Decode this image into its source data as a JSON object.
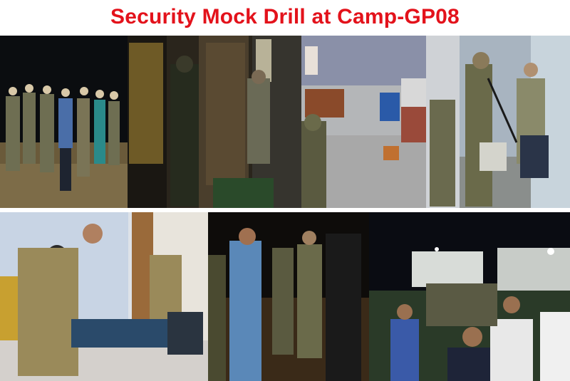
{
  "title": "Security Mock Drill at Camp-GP08",
  "colors": {
    "title": "#e3121b",
    "background": "#ffffff"
  },
  "photos": [
    {
      "name": "night-lineup-photo",
      "depicts": "uniformed personnel lined up at night"
    },
    {
      "name": "doorway-entry-photo",
      "depicts": "armed personnel at a doorway"
    },
    {
      "name": "office-room-photo",
      "depicts": "office room with chairs and soldier with rifle"
    },
    {
      "name": "captive-scene-photo",
      "depicts": "soldiers with rifles and a kneeling man"
    },
    {
      "name": "bedroom-scene-photo",
      "depicts": "soldier with a man lying on the floor"
    },
    {
      "name": "night-briefing-photo",
      "depicts": "group briefing at night"
    },
    {
      "name": "camp-gathering-photo",
      "depicts": "personnel gathered outside camp buildings at night"
    }
  ]
}
